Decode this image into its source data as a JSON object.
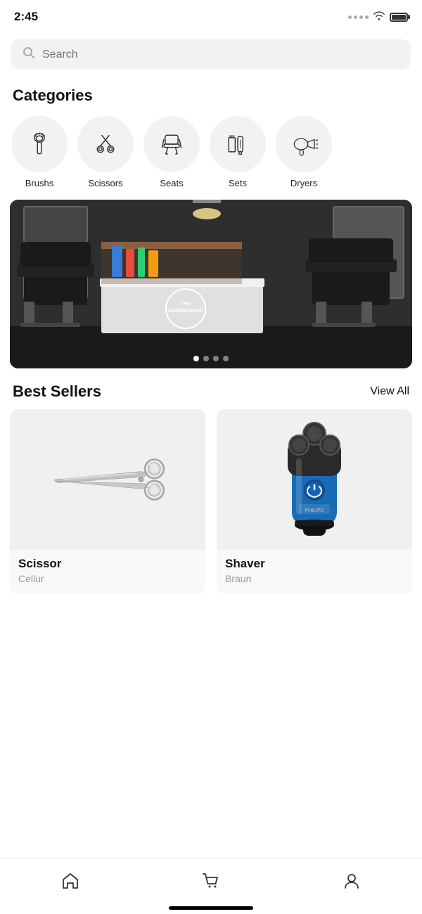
{
  "statusBar": {
    "time": "2:45"
  },
  "search": {
    "placeholder": "Search"
  },
  "categories": {
    "sectionTitle": "Categories",
    "items": [
      {
        "id": "brushes",
        "label": "Brushs"
      },
      {
        "id": "scissors",
        "label": "Scissors"
      },
      {
        "id": "seats",
        "label": "Seats"
      },
      {
        "id": "sets",
        "label": "Sets"
      },
      {
        "id": "dryers",
        "label": "Dryers"
      }
    ]
  },
  "banner": {
    "dots": [
      {
        "active": true
      },
      {
        "active": false
      },
      {
        "active": false
      },
      {
        "active": false
      }
    ]
  },
  "bestSellers": {
    "sectionTitle": "Best Sellers",
    "viewAllLabel": "View All",
    "products": [
      {
        "id": "scissor",
        "name": "Scissor",
        "brand": "Cellur"
      },
      {
        "id": "shaver",
        "name": "Shaver",
        "brand": "Braun"
      }
    ]
  },
  "bottomNav": {
    "items": [
      {
        "id": "home",
        "icon": "home-icon"
      },
      {
        "id": "cart",
        "icon": "cart-icon"
      },
      {
        "id": "profile",
        "icon": "profile-icon"
      }
    ]
  },
  "colors": {
    "accent": "#1a7acc",
    "background": "#ffffff",
    "categoryBg": "#f2f2f2",
    "productBg": "#f0f0f0"
  }
}
